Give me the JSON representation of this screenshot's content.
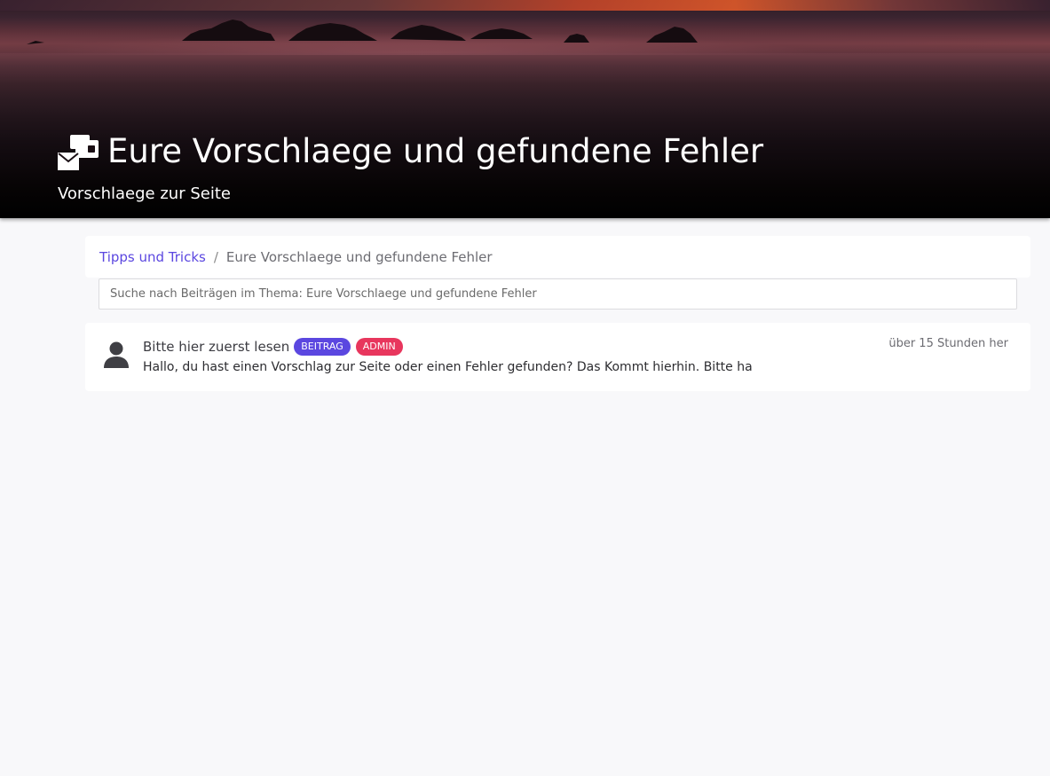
{
  "hero": {
    "title": "Eure Vorschlaege und gefundene Fehler",
    "subtitle": "Vorschlaege zur Seite",
    "icon": "mail-bulk-icon"
  },
  "breadcrumb": {
    "parent_label": "Tipps und Tricks",
    "separator": "/",
    "current_label": "Eure Vorschlaege und gefundene Fehler"
  },
  "search": {
    "placeholder": "Suche nach Beiträgen im Thema: Eure Vorschlaege und gefundene Fehler",
    "value": ""
  },
  "posts": [
    {
      "avatar_icon": "user-icon",
      "title": "Bitte hier zuerst lesen",
      "badges": [
        {
          "label": "BEITRAG",
          "color": "#5b47e0"
        },
        {
          "label": "ADMIN",
          "color": "#e8365d"
        }
      ],
      "time": "über 15 Stunden her",
      "excerpt": "Hallo, du hast einen Vorschlag zur Seite oder einen Fehler gefunden? Das Kommt hierhin. Bitte ha"
    }
  ],
  "colors": {
    "accent": "#5b47e0",
    "admin_badge": "#e8365d",
    "page_background": "#f8f8fa"
  }
}
